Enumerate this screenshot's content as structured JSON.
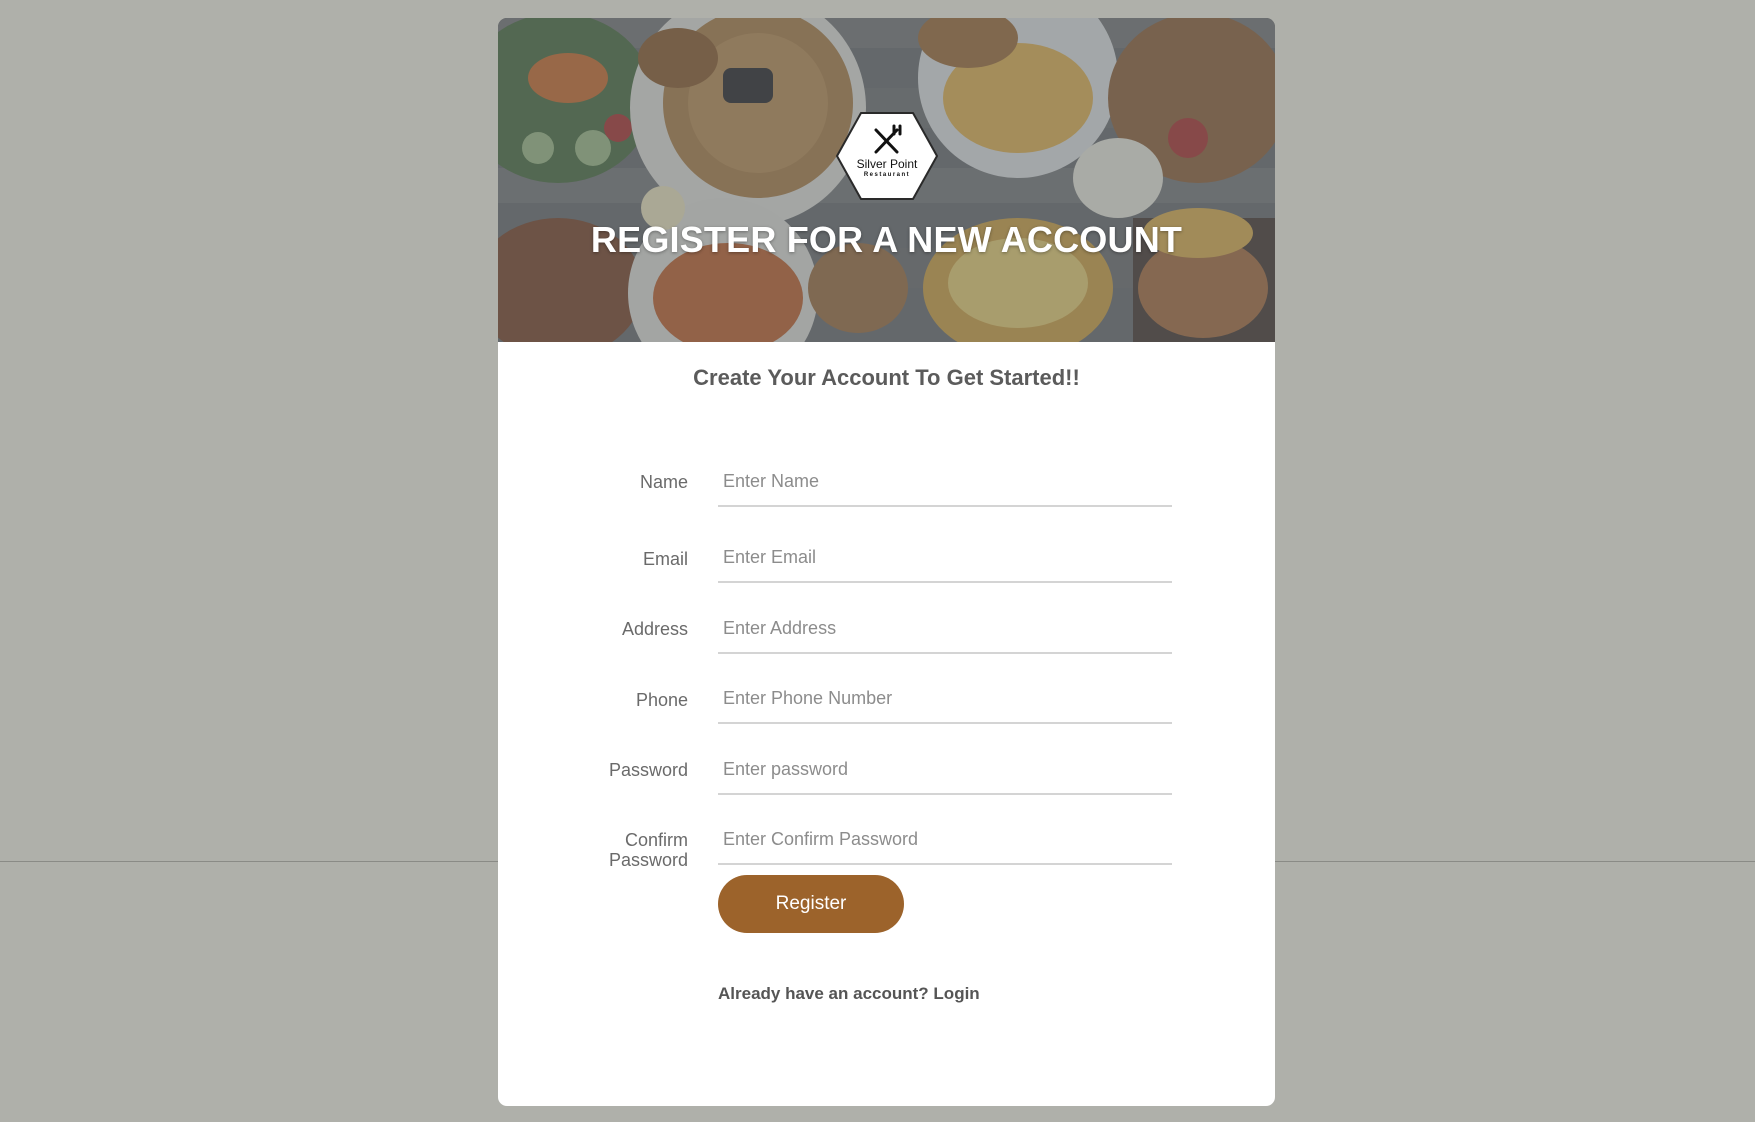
{
  "colors": {
    "page_background": "#afb0aa",
    "card_background": "#ffffff",
    "hero_overlay": "#5a6673",
    "button_background": "#9c632b",
    "button_text": "#ffffff",
    "label_text": "#6a6a6a",
    "field_underline": "#d4d4d4"
  },
  "logo": {
    "icon": "fork-knife-icon",
    "name": "Silver Point",
    "sub": "Restaurant"
  },
  "header": {
    "title": "REGISTER FOR A NEW ACCOUNT",
    "background": "food-platter-photo"
  },
  "form": {
    "subtitle": "Create Your Account To Get Started!!",
    "fields": {
      "name": {
        "label": "Name",
        "placeholder": "Enter Name",
        "value": ""
      },
      "email": {
        "label": "Email",
        "placeholder": "Enter Email",
        "value": ""
      },
      "address": {
        "label": "Address",
        "placeholder": "Enter Address",
        "value": ""
      },
      "phone": {
        "label": "Phone",
        "placeholder": "Enter Phone Number",
        "value": ""
      },
      "password": {
        "label": "Password",
        "placeholder": "Enter password",
        "value": ""
      },
      "confirm_password": {
        "label_line1": "Confirm",
        "label_line2": "Password",
        "placeholder": "Enter Confirm Password",
        "value": ""
      }
    },
    "submit_label": "Register",
    "login_prompt": "Already have an account?",
    "login_link": "Login"
  }
}
